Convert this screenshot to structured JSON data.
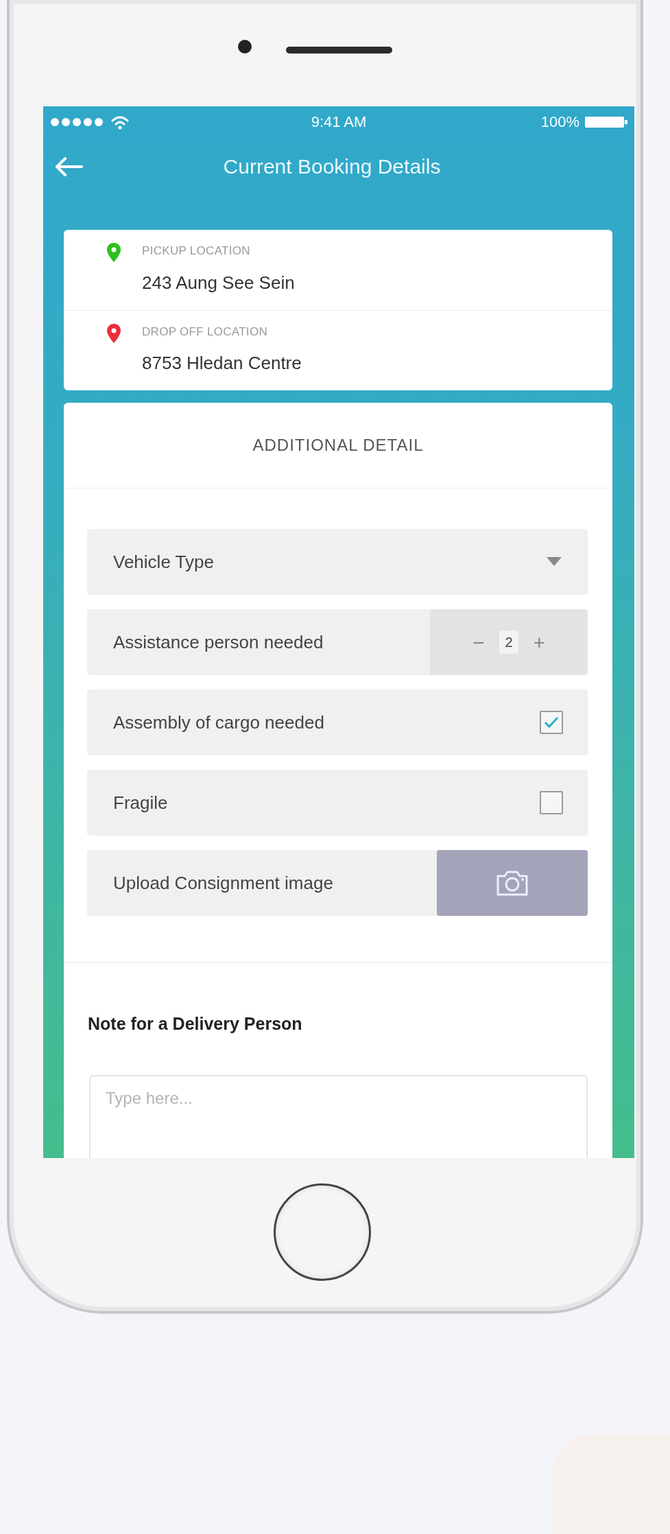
{
  "status_bar": {
    "time": "9:41 AM",
    "battery": "100%"
  },
  "header": {
    "title": "Current Booking Details"
  },
  "locations": [
    {
      "label": "PICKUP LOCATION",
      "address": "243 Aung See Sein",
      "color": "#2fbf1f"
    },
    {
      "label": "DROP OFF LOCATION",
      "address": "8753 Hledan Centre",
      "color": "#e8303a"
    }
  ],
  "details": {
    "title": "ADDITIONAL DETAIL",
    "items": [
      {
        "kind": "dropdown",
        "label": "Vehicle Type"
      },
      {
        "kind": "stepper",
        "label": "Assistance person needed",
        "decrement": "−",
        "value": "2",
        "increment": "+"
      },
      {
        "kind": "checkbox",
        "label": "Assembly of cargo needed",
        "checked": true
      },
      {
        "kind": "checkbox",
        "label": "Fragile",
        "checked": false
      },
      {
        "kind": "upload",
        "label": "Upload Consignment image"
      }
    ]
  },
  "note": {
    "label": "Note for a Delivery Person",
    "placeholder": "Type here..."
  }
}
